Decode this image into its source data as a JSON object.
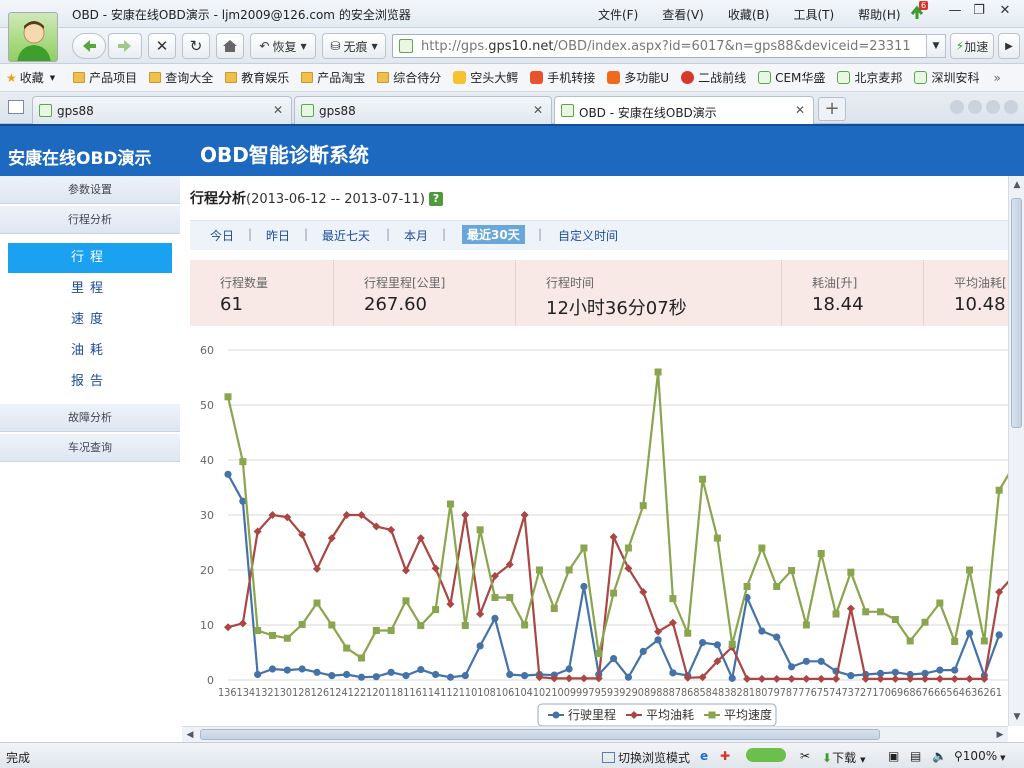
{
  "window": {
    "title": "OBD - 安康在线OBD演示 - ljm2009@126.com 的安全浏览器",
    "menu": [
      "文件(F)",
      "查看(V)",
      "收藏(B)",
      "工具(T)",
      "帮助(H)"
    ],
    "update_badge": "6"
  },
  "toolbar": {
    "restore_label": "恢复",
    "private_label": "无痕",
    "url_prefix": "http://gps.",
    "url_host": "gps10.net",
    "url_rest": "/OBD/index.aspx?id=6017&n=gps88&deviceid=23311",
    "accelerate_label": "加速"
  },
  "bookmarks": {
    "favorites_label": "收藏",
    "items": [
      "产品项目",
      "查询大全",
      "教育娱乐",
      "产品淘宝",
      "综合待分",
      "空头大鳄",
      "手机转接",
      "多功能U",
      "二战前线",
      "CEM华盛",
      "北京麦邦",
      "深圳安科"
    ],
    "more": "»"
  },
  "tabs": [
    {
      "label": "gps88"
    },
    {
      "label": "gps88"
    },
    {
      "label": "OBD - 安康在线OBD演示"
    }
  ],
  "app": {
    "brand": "安康在线OBD演示",
    "system_title": "OBD智能诊断系统"
  },
  "sidebar": {
    "group_params": "参数设置",
    "group_trip": "行程分析",
    "items": [
      "行程",
      "里程",
      "速度",
      "油耗",
      "报告"
    ],
    "group_fault": "故障分析",
    "group_vehicle": "车况查询"
  },
  "main": {
    "title": "行程分析",
    "range": "(2013-06-12 -- 2013-07-11)",
    "help": "?"
  },
  "range_buttons": [
    "今日",
    "昨日",
    "最近七天",
    "本月",
    "最近30天",
    "自定义时间"
  ],
  "stats": [
    {
      "label": "行程数量",
      "value": "61"
    },
    {
      "label": "行程里程[公里]",
      "value": "267.60"
    },
    {
      "label": "行程时间",
      "value": "12小时36分07秒"
    },
    {
      "label": "耗油[升]",
      "value": "18.44"
    },
    {
      "label": "平均油耗[",
      "value": "10.48"
    }
  ],
  "chart_data": {
    "type": "line",
    "x": [
      "136",
      "134",
      "132",
      "130",
      "128",
      "126",
      "124",
      "122",
      "120",
      "118",
      "116",
      "114",
      "112",
      "110",
      "108",
      "106",
      "104",
      "102",
      "100",
      "99",
      "97",
      "95",
      "93",
      "92",
      "90",
      "89",
      "88",
      "87",
      "86",
      "85",
      "84",
      "83",
      "82",
      "81",
      "80",
      "79",
      "78",
      "77",
      "76",
      "75",
      "74",
      "73",
      "72",
      "71",
      "70",
      "69",
      "68",
      "67",
      "66",
      "65",
      "64",
      "63",
      "62",
      "61"
    ],
    "x_tick_text": "1361341321301281261241221201181161141121101081061041021009997959392908988878685848382818079787776757473727170696867666564636261",
    "ylim": [
      0,
      60
    ],
    "yticks": [
      0,
      10,
      20,
      30,
      40,
      50,
      60
    ],
    "grid": true,
    "legend_position": "bottom",
    "series": [
      {
        "name": "行驶里程",
        "color": "#4572a7",
        "marker": "circle",
        "values": [
          37.4,
          32.5,
          1.0,
          2.0,
          1.8,
          2.0,
          1.4,
          0.8,
          1.0,
          0.5,
          0.6,
          1.4,
          0.8,
          1.9,
          1.0,
          0.5,
          0.8,
          6.2,
          11.2,
          1.0,
          0.8,
          1.0,
          0.9,
          2.0,
          17.0,
          1.0,
          3.9,
          0.5,
          5.2,
          7.3,
          1.3,
          0.8,
          6.8,
          6.4,
          0.3,
          15.0,
          8.9,
          7.8,
          2.4,
          3.4,
          3.4,
          1.6,
          0.8,
          1.0,
          1.2,
          1.4,
          1.0,
          1.2,
          1.8,
          1.8,
          8.5,
          0.8,
          8.2
        ]
      },
      {
        "name": "平均油耗",
        "color": "#aa4643",
        "marker": "diamond",
        "values": [
          9.6,
          10.3,
          27.0,
          30.0,
          29.6,
          26.4,
          20.2,
          25.8,
          30.0,
          30.0,
          27.9,
          27.3,
          19.9,
          25.8,
          20.3,
          13.8,
          30.0,
          12.0,
          18.9,
          21.0,
          30.0,
          0.5,
          0.3,
          0.3,
          0.3,
          0.3,
          26.0,
          20.3,
          16.0,
          8.8,
          10.4,
          0.4,
          0.5,
          3.4,
          6.0,
          0.2,
          0.2,
          0.2,
          0.2,
          0.2,
          0.2,
          0.2,
          13.0,
          0.2,
          0.2,
          0.2,
          0.2,
          0.2,
          0.2,
          0.2,
          0.2,
          0.2,
          16.0,
          19.0
        ]
      },
      {
        "name": "平均速度",
        "color": "#89a54e",
        "marker": "square",
        "values": [
          51.5,
          39.7,
          9.0,
          8.1,
          7.6,
          10.1,
          14.0,
          10.0,
          5.8,
          4.0,
          9.0,
          9.0,
          14.4,
          9.9,
          12.8,
          32.0,
          9.9,
          27.3,
          15.0,
          15.0,
          10.0,
          20.0,
          13.0,
          20.0,
          24.0,
          4.8,
          15.8,
          24.0,
          31.7,
          56.0,
          14.8,
          8.5,
          36.5,
          25.8,
          6.5,
          17.0,
          24.0,
          17.0,
          19.9,
          10.0,
          23.0,
          12.0,
          19.6,
          12.4,
          12.4,
          11.0,
          7.1,
          10.5,
          14.0,
          7.0,
          20.0,
          7.1,
          34.5,
          39.0
        ]
      }
    ]
  },
  "statusbar": {
    "done": "完成",
    "mode": "切换浏览模式",
    "download": "下载",
    "zoom": "100%"
  }
}
